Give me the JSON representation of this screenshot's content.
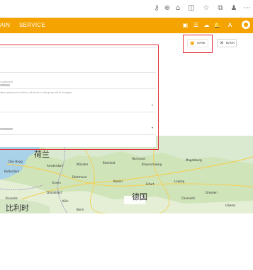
{
  "browser": {
    "icons": [
      "key-icon",
      "zoom-icon",
      "reader-icon",
      "extensions-icon",
      "favorite-icon",
      "collections-icon",
      "profile-icon",
      "more-icon"
    ]
  },
  "header": {
    "nav": [
      "AIN",
      "SERVICE"
    ],
    "accent": "#f5a300"
  },
  "actions": {
    "save_label": "SAVE",
    "back_label": "BACK"
  },
  "form": {
    "password_label": "n password",
    "confirm_hint": "alarm password of device, all device in this group will be changed"
  },
  "map": {
    "countries": [
      "荷兰",
      "德国",
      "比利时"
    ],
    "cities": [
      "Den Haag",
      "Rotterdam",
      "Amsterdam",
      "Münster",
      "Bielefeld",
      "Hannover",
      "Braunschweig",
      "Magdeburg",
      "Dortmund",
      "Essen",
      "Düsseldorf",
      "Köln",
      "Brussels",
      "Bonn",
      "Kassel",
      "Erfurt",
      "Leipzig",
      "Dresden",
      "Chemnitz",
      "Liberec"
    ]
  }
}
